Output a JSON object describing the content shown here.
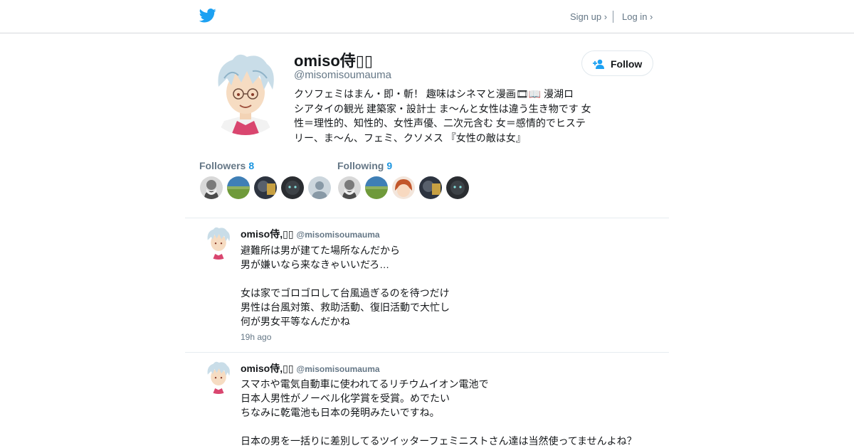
{
  "header": {
    "signup_label": "Sign up ›",
    "login_label": "Log in ›",
    "brand_color": "#1da1f2"
  },
  "profile": {
    "display_name": "omiso侍▯▯",
    "screen_name": "@misomisoumauma",
    "follow_label": "Follow",
    "bio_lines": [
      "クソフェミはまん・即・斬！ 趣味はシネマと漫画🎞📖 漫湖ロ",
      "シアタイの観光 建築家・設計士 ま～んと女性は違う生き物です 女",
      "性＝理性的、知性的、女性声優、二次元含む 女＝感情的でヒステ",
      "リー、ま～ん、フェミ、クソメス 『女性の敵は女』"
    ]
  },
  "followers": {
    "label": "Followers",
    "count": "8"
  },
  "following": {
    "label": "Following",
    "count": "9"
  },
  "tweets": [
    {
      "name": "omiso侍,▯▯",
      "handle": "@misomisoumauma",
      "lines": [
        "避難所は男が建てた場所なんだから",
        "男が嫌いなら来なきゃいいだろ…",
        "",
        "女は家でゴロゴロして台風過ぎるのを待つだけ",
        "男性は台風対策、救助活動、復旧活動で大忙し",
        "何が男女平等なんだかね"
      ],
      "time": "19h ago"
    },
    {
      "name": "omiso侍,▯▯",
      "handle": "@misomisoumauma",
      "lines": [
        "スマホや電気自動車に使われてるリチウムイオン電池で",
        "日本人男性がノーベル化学賞を受賞。めでたい",
        "ちなみに乾電池も日本の発明みたいですね。",
        "",
        "日本の男を一括りに差別してるツイッターフェミニストさん達は当然使ってませんよね？"
      ]
    }
  ]
}
